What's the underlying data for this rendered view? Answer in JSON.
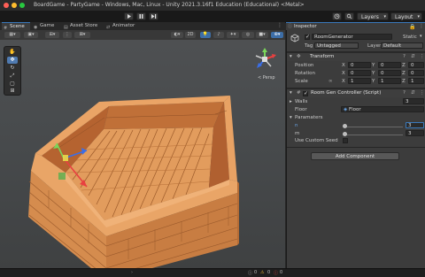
{
  "window": {
    "title": "BoardGame - PartyGame - Windows, Mac, Linux - Unity 2021.3.16f1 Education (Educational) <Metal>"
  },
  "toolbar": {
    "layers_label": "Layers",
    "layout_label": "Layout"
  },
  "tabs": {
    "scene": "Scene",
    "game": "Game",
    "asset_store": "Asset Store",
    "animator": "Animator"
  },
  "scene_toolbar": {
    "mode_2d": "2D"
  },
  "viewport": {
    "camera_label": "< Persp",
    "gizmo_axes": [
      "x",
      "y",
      "z"
    ]
  },
  "inspector": {
    "tab_label": "Inspector",
    "object_name": "RoomGenerator",
    "static_label": "Static",
    "tag_label": "Tag",
    "tag_value": "Untagged",
    "layer_label": "Layer",
    "layer_value": "Default",
    "transform": {
      "header": "Transform",
      "position_label": "Position",
      "rotation_label": "Rotation",
      "scale_label": "Scale",
      "position": {
        "x": "0",
        "y": "0",
        "z": "0"
      },
      "rotation": {
        "x": "0",
        "y": "0",
        "z": "0"
      },
      "scale": {
        "x": "1",
        "y": "1",
        "z": "1"
      }
    },
    "component": {
      "header": "Room Gen Controller (Script)",
      "walls_label": "Walls",
      "walls_count": "3",
      "floor_label": "Floor",
      "floor_value": "Floor",
      "parameters_label": "Paramaters",
      "n_label": "n",
      "n_value": "3",
      "m_label": "m",
      "m_value": "3",
      "custom_seed_label": "Use Custom Seed"
    },
    "add_component": "Add Component"
  },
  "status": {
    "warnings": "0",
    "errors": "0"
  },
  "colors": {
    "accent": "#3a79bb",
    "wall": "#d98a4c",
    "floor": "#e09a5a",
    "viewport_bg": "#4a4c4e"
  }
}
